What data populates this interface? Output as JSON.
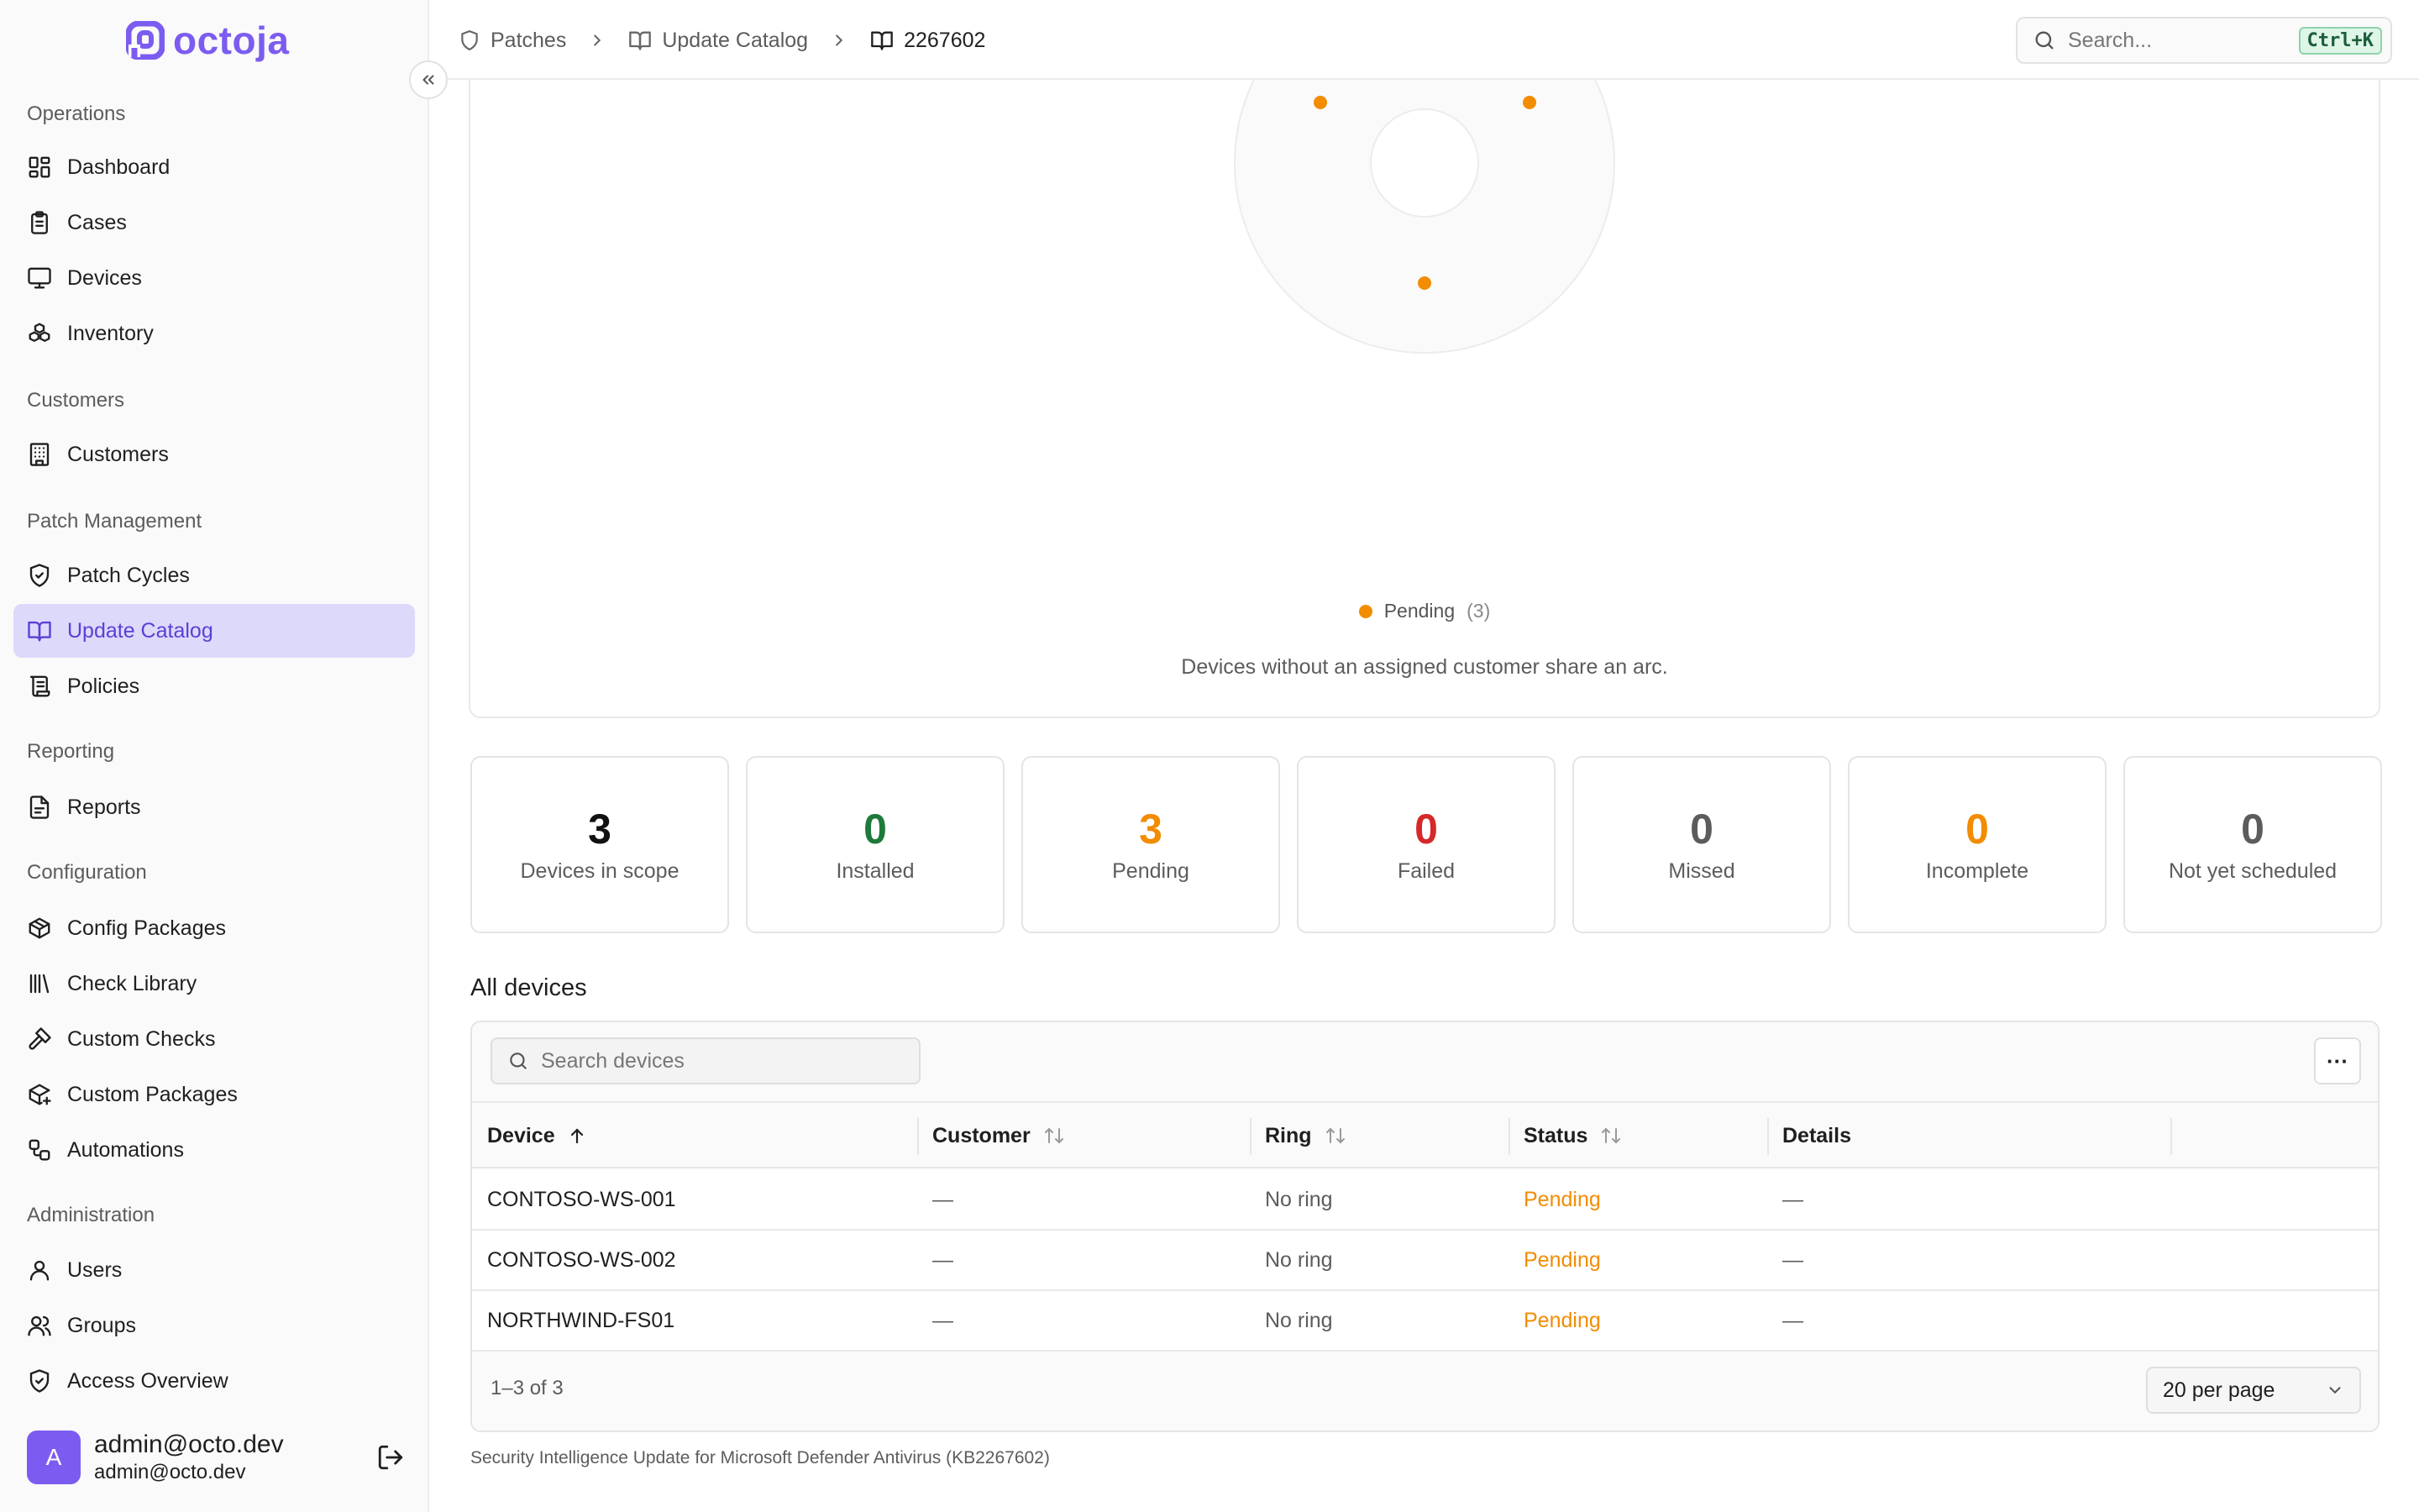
{
  "brand": {
    "name": "octoja",
    "accent": "#7c5cf0"
  },
  "sidebar": {
    "groups": [
      {
        "label": "Operations",
        "items": [
          {
            "label": "Dashboard",
            "icon": "dashboard-icon"
          },
          {
            "label": "Cases",
            "icon": "clipboard-icon"
          },
          {
            "label": "Devices",
            "icon": "monitor-icon"
          },
          {
            "label": "Inventory",
            "icon": "boxes-icon"
          }
        ]
      },
      {
        "label": "Customers",
        "items": [
          {
            "label": "Customers",
            "icon": "building-icon"
          }
        ]
      },
      {
        "label": "Patch Management",
        "items": [
          {
            "label": "Patch Cycles",
            "icon": "shield-check-icon"
          },
          {
            "label": "Update Catalog",
            "icon": "book-open-icon",
            "active": true
          },
          {
            "label": "Policies",
            "icon": "scroll-icon"
          }
        ]
      },
      {
        "label": "Reporting",
        "items": [
          {
            "label": "Reports",
            "icon": "report-icon"
          }
        ]
      },
      {
        "label": "Configuration",
        "items": [
          {
            "label": "Config Packages",
            "icon": "package-icon"
          },
          {
            "label": "Check Library",
            "icon": "library-icon"
          },
          {
            "label": "Custom Checks",
            "icon": "hammer-icon"
          },
          {
            "label": "Custom Packages",
            "icon": "package-plus-icon"
          },
          {
            "label": "Automations",
            "icon": "workflow-icon"
          }
        ]
      },
      {
        "label": "Administration",
        "items": [
          {
            "label": "Users",
            "icon": "user-icon"
          },
          {
            "label": "Groups",
            "icon": "users-icon"
          },
          {
            "label": "Access Overview",
            "icon": "shield-icon"
          }
        ]
      }
    ],
    "user": {
      "initial": "A",
      "name": "admin@octo.dev",
      "email": "admin@octo.dev"
    }
  },
  "header": {
    "breadcrumbs": [
      {
        "label": "Patches",
        "icon": "shield-icon"
      },
      {
        "label": "Update Catalog",
        "icon": "book-open-icon"
      },
      {
        "label": "2267602",
        "icon": "book-open-icon"
      }
    ],
    "search": {
      "placeholder": "Search...",
      "shortcut": "Ctrl+K"
    }
  },
  "chart": {
    "legend": [
      {
        "label": "Pending",
        "count": "(3)",
        "color": "#f28c00"
      }
    ],
    "note": "Devices without an assigned customer share an arc."
  },
  "stats": [
    {
      "value": "3",
      "label": "Devices in scope",
      "color": "#111111"
    },
    {
      "value": "0",
      "label": "Installed",
      "color": "#1e7a3a"
    },
    {
      "value": "3",
      "label": "Pending",
      "color": "#f28c00"
    },
    {
      "value": "0",
      "label": "Failed",
      "color": "#d62828"
    },
    {
      "value": "0",
      "label": "Missed",
      "color": "#5c5c5c"
    },
    {
      "value": "0",
      "label": "Incomplete",
      "color": "#f28c00"
    },
    {
      "value": "0",
      "label": "Not yet scheduled",
      "color": "#5c5c5c"
    }
  ],
  "devices": {
    "title": "All devices",
    "search_placeholder": "Search devices",
    "more_label": "···",
    "columns": [
      "Device",
      "Customer",
      "Ring",
      "Status",
      "Details"
    ],
    "rows": [
      {
        "device": "CONTOSO-WS-001",
        "customer": "—",
        "ring": "No ring",
        "status": "Pending",
        "details": "—"
      },
      {
        "device": "CONTOSO-WS-002",
        "customer": "—",
        "ring": "No ring",
        "status": "Pending",
        "details": "—"
      },
      {
        "device": "NORTHWIND-FS01",
        "customer": "—",
        "ring": "No ring",
        "status": "Pending",
        "details": "—"
      }
    ],
    "range": "1–3 of 3",
    "per_page": "20 per page"
  },
  "footnote": "Security Intelligence Update for Microsoft Defender Antivirus (KB2267602)"
}
